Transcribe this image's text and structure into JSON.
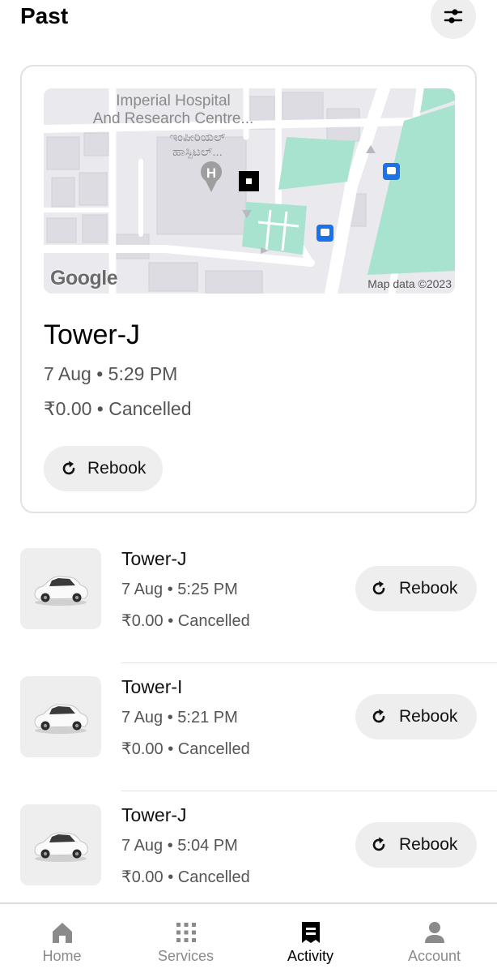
{
  "header": {
    "title": "Past",
    "filter_icon": "sliders-icon"
  },
  "featured": {
    "map": {
      "place_label_line1": "Imperial Hospital",
      "place_label_line2": "And Research Centre...",
      "place_label_local_line1": "ಇಂಪೀರಿಯಲ್",
      "place_label_local_line2": "ಹಾಸ್ಪಿಟಲ್...",
      "logo": "Google",
      "attribution": "Map data ©2023",
      "colors": {
        "land": "#e9e9ee",
        "road": "#ffffff",
        "park": "#a8e3cf",
        "building": "#dcdce2"
      }
    },
    "title": "Tower-J",
    "date": "7 Aug • 5:29 PM",
    "price_status": "₹0.00 • Cancelled",
    "rebook_label": "Rebook"
  },
  "trips": [
    {
      "title": "Tower-J",
      "date": "7 Aug • 5:25 PM",
      "price_status": "₹0.00 • Cancelled",
      "rebook_label": "Rebook"
    },
    {
      "title": "Tower-I",
      "date": "7 Aug • 5:21 PM",
      "price_status": "₹0.00 • Cancelled",
      "rebook_label": "Rebook"
    },
    {
      "title": "Tower-J",
      "date": "7 Aug • 5:04 PM",
      "price_status": "₹0.00 • Cancelled",
      "rebook_label": "Rebook"
    }
  ],
  "nav": {
    "items": [
      {
        "label": "Home",
        "icon": "home-icon"
      },
      {
        "label": "Services",
        "icon": "grid-icon"
      },
      {
        "label": "Activity",
        "icon": "receipt-icon"
      },
      {
        "label": "Account",
        "icon": "person-icon"
      }
    ],
    "active": "Activity"
  },
  "colors": {
    "chip_bg": "#eeeeee",
    "text_primary": "#111111",
    "text_secondary": "#555555",
    "nav_inactive": "#8a8a8a"
  }
}
